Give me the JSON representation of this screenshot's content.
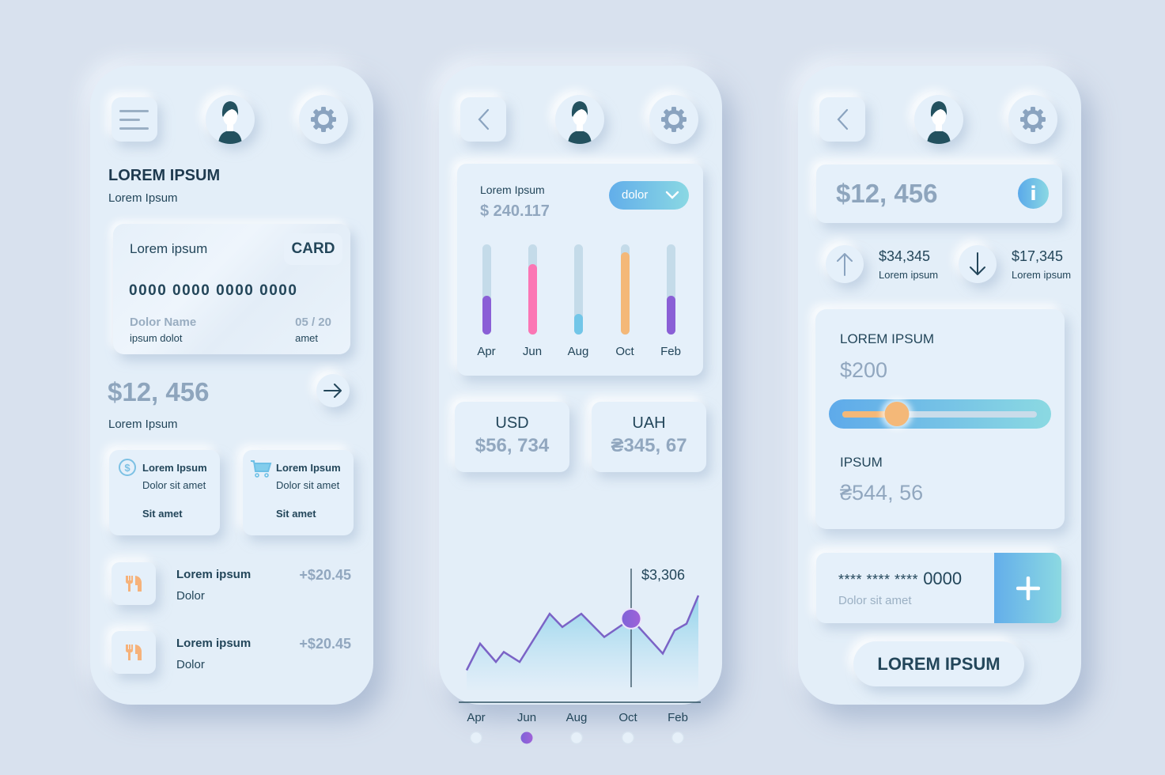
{
  "colors": {
    "background": "#d8e1ee",
    "phone": "#e3eef8",
    "text_dark": "#23465a",
    "text_muted": "#8ea5bd",
    "accent_gradient_start": "#5eaaea",
    "accent_gradient_end": "#8bd9e2",
    "purple": "#8a5fd6",
    "pink": "#fb76b4",
    "orange": "#f4b878",
    "cyan": "#72c6e8"
  },
  "screen1": {
    "header": {
      "menu_icon": "hamburger-icon",
      "avatar_icon": "user-avatar-icon",
      "settings_icon": "gear-icon"
    },
    "title": "LOREM IPSUM",
    "subtitle": "Lorem Ipsum",
    "card": {
      "label": "Lorem ipsum",
      "tag": "CARD",
      "number": "0000 0000 0000 0000",
      "holder_label": "Dolor Name",
      "holder_value": "ipsum dolot",
      "expiry_label": "05 / 20",
      "expiry_value": "amet"
    },
    "balance": {
      "amount": "$12, 456",
      "label": "Lorem Ipsum",
      "action_icon": "arrow-right-icon"
    },
    "tiles": [
      {
        "icon": "dollar-circle-icon",
        "title": "Lorem Ipsum",
        "desc": "Dolor sit amet",
        "footer": "Sit amet"
      },
      {
        "icon": "shopping-cart-icon",
        "title": "Lorem Ipsum",
        "desc": "Dolor sit amet",
        "footer": "Sit amet"
      }
    ],
    "transactions": [
      {
        "icon": "fork-knife-icon",
        "title": "Lorem ipsum",
        "subtitle": "Dolor",
        "amount": "+$20.45"
      },
      {
        "icon": "fork-knife-icon",
        "title": "Lorem ipsum",
        "subtitle": "Dolor",
        "amount": "+$20.45"
      }
    ]
  },
  "screen2": {
    "header": {
      "back_icon": "chevron-left-icon",
      "avatar_icon": "user-avatar-icon",
      "settings_icon": "gear-icon"
    },
    "summary": {
      "label": "Lorem Ipsum",
      "value": "$ 240.117",
      "dropdown_value": "dolor"
    },
    "currencies": [
      {
        "code": "USD",
        "value": "$56, 734"
      },
      {
        "code": "UAH",
        "value": "₴345, 67"
      }
    ]
  },
  "screen3": {
    "header": {
      "back_icon": "chevron-left-icon",
      "avatar_icon": "user-avatar-icon",
      "settings_icon": "gear-icon"
    },
    "balance": "$12, 456",
    "info_glyph": "i",
    "stats": [
      {
        "direction": "up",
        "value": "$34,345",
        "label": "Lorem ipsum"
      },
      {
        "direction": "down",
        "value": "$17,345",
        "label": "Lorem ipsum"
      }
    ],
    "transfer": {
      "heading": "LOREM IPSUM",
      "amount": "$200",
      "slider_fraction": 0.23,
      "heading2": "IPSUM",
      "amount2": "₴544, 56"
    },
    "saved_card": {
      "masked": "**** **** ****",
      "last4": "0000",
      "subtitle": "Dolor sit amet",
      "plus_glyph": "+"
    },
    "cta_label": "LOREM IPSUM"
  },
  "chart_data": [
    {
      "type": "bar",
      "title": "Lorem Ipsum",
      "categories": [
        "Apr",
        "Jun",
        "Aug",
        "Oct",
        "Feb"
      ],
      "values": [
        43,
        78,
        23,
        91,
        43
      ],
      "ylim": [
        0,
        100
      ],
      "bar_colors": [
        "#8a5fd6",
        "#fb76b4",
        "#72c6e8",
        "#f4b878",
        "#8a5fd6"
      ],
      "grid": false
    },
    {
      "type": "area",
      "categories": [
        "Apr",
        "Jun",
        "Aug",
        "Oct",
        "Feb"
      ],
      "series": [
        {
          "name": "value",
          "values": [
            10,
            42,
            20,
            32,
            20,
            78,
            62,
            78,
            50,
            72,
            30,
            58,
            66,
            100
          ]
        }
      ],
      "ylim": [
        0,
        110
      ],
      "highlight": {
        "index": 9,
        "label": "$3,306"
      },
      "active_page": 1,
      "grid": false
    }
  ]
}
